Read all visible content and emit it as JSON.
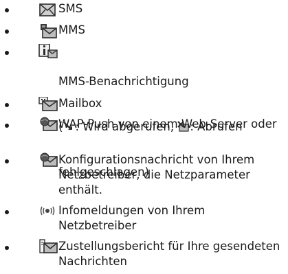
{
  "items": [
    {
      "icon": "sms-envelope-icon",
      "text": "SMS"
    },
    {
      "icon": "mms-envelope-icon",
      "text": "MMS"
    },
    {
      "icon": "mms-notification-icon",
      "line1": "MMS-Benachrichtigung",
      "line2_prefix": "(",
      "line2_mid": ": Wird abgerufen, ",
      "line2_suffix": ": Abrufen",
      "line3": "fehlgeschlagen)",
      "inline_icons": [
        "retrieving-arrow-icon",
        "retrieval-failed-icon"
      ]
    },
    {
      "icon": "mailbox-envelope-icon",
      "text": "Mailbox"
    },
    {
      "icon": "wap-push-icon",
      "text": "WAP-Push von einem Web-Server oder"
    },
    {
      "icon": "configuration-message-icon",
      "text": "Konfigurationsnachricht von Ihrem Netzbetreiber, die Netzparameter enthält."
    },
    {
      "icon": "info-broadcast-icon",
      "text": "Infomeldungen von Ihrem Netzbetreiber"
    },
    {
      "icon": "delivery-report-icon",
      "text": "Zustellungsbericht für Ihre gesendeten Nachrichten"
    }
  ]
}
